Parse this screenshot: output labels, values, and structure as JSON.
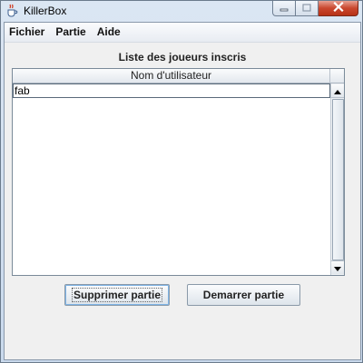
{
  "window": {
    "title": "KillerBox",
    "controls": {
      "minimize": "minimize",
      "maximize": "maximize",
      "close": "close"
    }
  },
  "menubar": {
    "items": [
      {
        "label": "Fichier"
      },
      {
        "label": "Partie"
      },
      {
        "label": "Aide"
      }
    ]
  },
  "panel": {
    "title": "Liste des joueurs inscris"
  },
  "table": {
    "columns": [
      "Nom d'utilisateur"
    ],
    "rows": [
      {
        "username": "fab",
        "selected": true
      }
    ]
  },
  "buttons": {
    "delete": "Supprimer partie",
    "start": "Demarrer partie"
  },
  "icons": {
    "app": "java-coffee-cup-icon",
    "minimize": "minimize-icon",
    "maximize": "maximize-icon",
    "close": "close-icon",
    "scroll_up": "triangle-up-icon",
    "scroll_down": "triangle-down-icon"
  },
  "colors": {
    "titlebar": "#c9d9ec",
    "close_button": "#c9472e",
    "background": "#f0f0f0"
  }
}
